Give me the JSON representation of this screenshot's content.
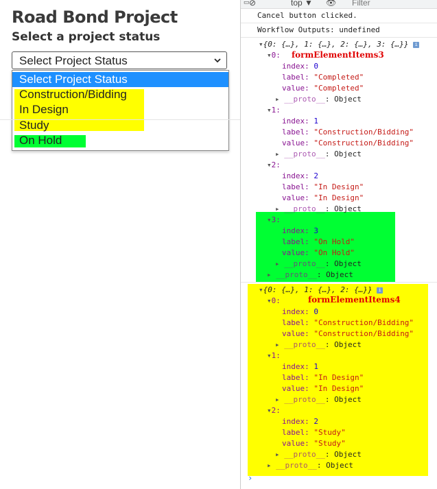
{
  "page": {
    "title": "Road Bond Project",
    "subtitle": "Select a project status"
  },
  "select": {
    "value": "Select Project Status",
    "options": [
      "Select Project Status",
      "Construction/Bidding",
      "In Design",
      "Study",
      "On Hold"
    ]
  },
  "devtools": {
    "context": "top",
    "filter_placeholder": "Filter",
    "log1": "Cancel button clicked.",
    "log2": "Workflow Outputs: undefined",
    "obj1": {
      "summary": "{0: {…}, 1: {…}, 2: {…}, 3: {…}}",
      "annotation": "formElementItems3",
      "items": [
        {
          "key": "0:",
          "index": "0",
          "label": "\"Completed\"",
          "value": "\"Completed\""
        },
        {
          "key": "1:",
          "index": "1",
          "label": "\"Construction/Bidding\"",
          "value": "\"Construction/Bidding\""
        },
        {
          "key": "2:",
          "index": "2",
          "label": "\"In Design\"",
          "value": "\"In Design\""
        },
        {
          "key": "3:",
          "index": "3",
          "label": "\"On Hold\"",
          "value": "\"On Hold\""
        }
      ]
    },
    "obj2": {
      "summary": "{0: {…}, 1: {…}, 2: {…}}",
      "annotation": "formElementItems4",
      "items": [
        {
          "key": "0:",
          "index": "0",
          "label": "\"Construction/Bidding\"",
          "value": "\"Construction/Bidding\""
        },
        {
          "key": "1:",
          "index": "1",
          "label": "\"In Design\"",
          "value": "\"In Design\""
        },
        {
          "key": "2:",
          "index": "2",
          "label": "\"Study\"",
          "value": "\"Study\""
        }
      ]
    },
    "labels": {
      "index": "index: ",
      "label": "label: ",
      "value": "value: ",
      "proto": "__proto__",
      "object": ": Object"
    },
    "colors": {
      "highlight_yellow": "#ffff00",
      "highlight_green": "#00ff33",
      "select_blue": "#1e90ff",
      "annotation_red": "#e00000"
    }
  }
}
